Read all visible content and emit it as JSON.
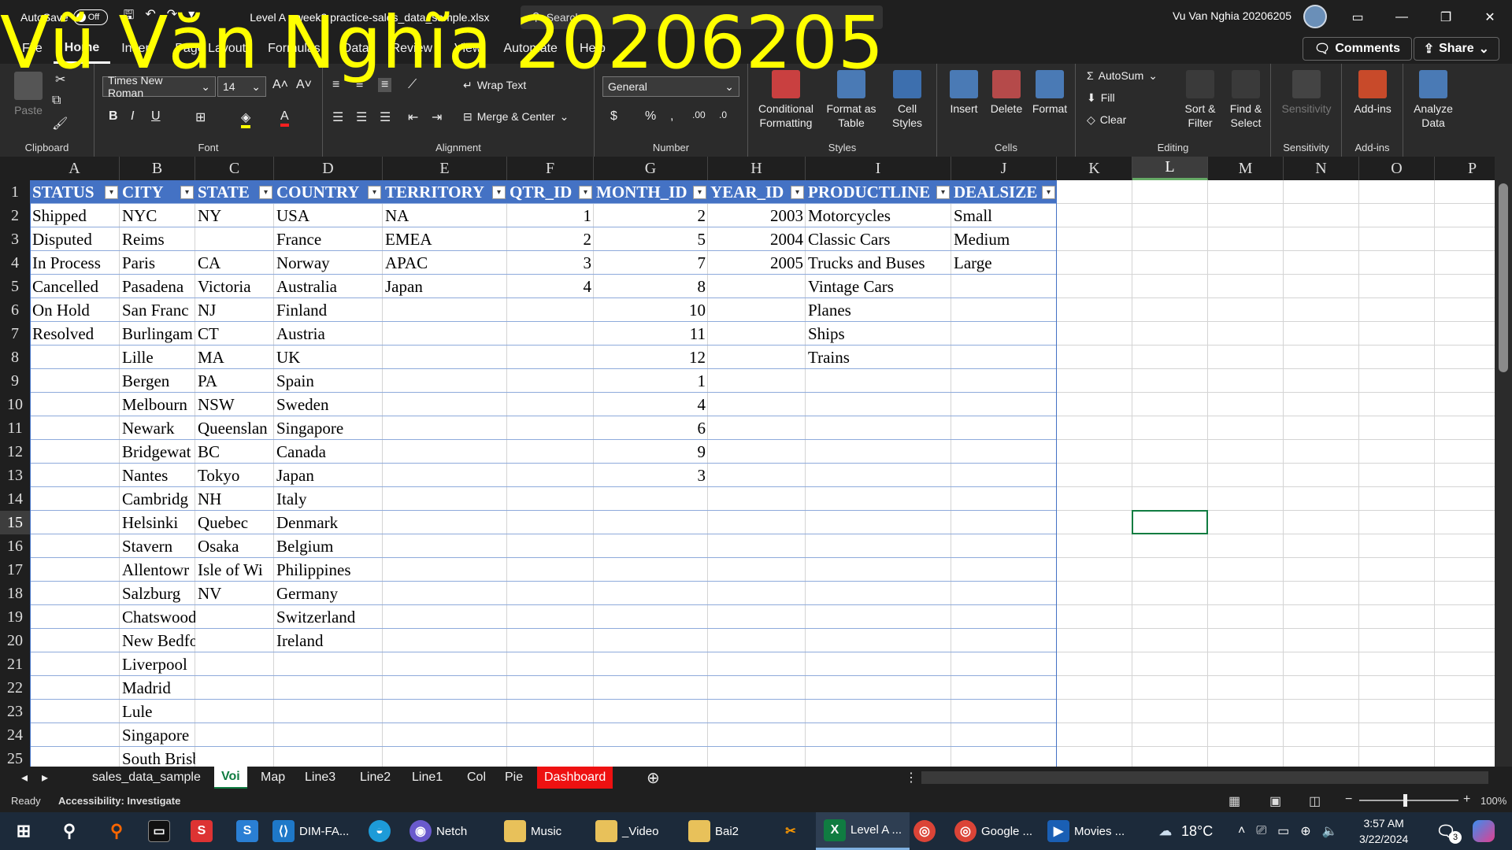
{
  "titlebar": {
    "autosave_label": "AutoSave",
    "autosave_state": "Off",
    "filename": "Level A - week2 practice-sales_data_sample.xlsx",
    "search_placeholder": "Search",
    "user_name": "Vu Van Nghia 20206205"
  },
  "tabs": [
    "File",
    "Home",
    "Insert",
    "Page Layout",
    "Formulas",
    "Data",
    "Review",
    "View",
    "Automate",
    "Help"
  ],
  "ribbon": {
    "comments_label": "Comments",
    "share_label": "Share",
    "clipboard": {
      "paste": "Paste",
      "label": "Clipboard"
    },
    "font": {
      "name": "Times New Roman",
      "size": "14",
      "label": "Font"
    },
    "alignment": {
      "wrap_text": "Wrap Text",
      "merge_center": "Merge & Center",
      "label": "Alignment"
    },
    "number": {
      "format": "General",
      "label": "Number"
    },
    "styles": {
      "conditional": "Conditional Formatting",
      "format_table": "Format as Table",
      "cell_styles": "Cell Styles",
      "label": "Styles"
    },
    "cells": {
      "insert": "Insert",
      "delete": "Delete",
      "format": "Format",
      "label": "Cells"
    },
    "editing": {
      "autosum": "AutoSum",
      "fill": "Fill",
      "clear": "Clear",
      "sort_filter": "Sort & Filter",
      "find_select": "Find & Select",
      "label": "Editing"
    },
    "sensitivity": {
      "button": "Sensitivity",
      "label": "Sensitivity"
    },
    "addins": {
      "button": "Add-ins",
      "label": "Add-ins"
    },
    "analyze": {
      "button": "Analyze Data"
    }
  },
  "columns": [
    "A",
    "B",
    "C",
    "D",
    "E",
    "F",
    "G",
    "H",
    "I",
    "J",
    "K",
    "L",
    "M",
    "N",
    "O",
    "P"
  ],
  "rows": [
    "1",
    "2",
    "3",
    "4",
    "5",
    "6",
    "7",
    "8",
    "9",
    "10",
    "11",
    "12",
    "13",
    "14",
    "15",
    "16",
    "17",
    "18",
    "19",
    "20",
    "21",
    "22",
    "23",
    "24",
    "25"
  ],
  "table_headers": [
    "STATUS",
    "CITY",
    "STATE",
    "COUNTRY",
    "TERRITORY",
    "QTR_ID",
    "MONTH_ID",
    "YEAR_ID",
    "PRODUCTLINE",
    "DEALSIZE"
  ],
  "table_rows": [
    [
      "Shipped",
      "NYC",
      "NY",
      "USA",
      "NA",
      "1",
      "2",
      "2003",
      "Motorcycles",
      "Small"
    ],
    [
      "Disputed",
      "Reims",
      "",
      "France",
      "EMEA",
      "2",
      "5",
      "2004",
      "Classic Cars",
      "Medium"
    ],
    [
      "In Process",
      "Paris",
      "CA",
      "Norway",
      "APAC",
      "3",
      "7",
      "2005",
      "Trucks and Buses",
      "Large"
    ],
    [
      "Cancelled",
      "Pasadena",
      "Victoria",
      "Australia",
      "Japan",
      "4",
      "8",
      "",
      "Vintage Cars",
      ""
    ],
    [
      "On Hold",
      "San Franc",
      "NJ",
      "Finland",
      "",
      "",
      "10",
      "",
      "Planes",
      ""
    ],
    [
      "Resolved",
      "Burlingam",
      "CT",
      "Austria",
      "",
      "",
      "11",
      "",
      "Ships",
      ""
    ],
    [
      "",
      "Lille",
      "MA",
      "UK",
      "",
      "",
      "12",
      "",
      "Trains",
      ""
    ],
    [
      "",
      "Bergen",
      "PA",
      "Spain",
      "",
      "",
      "1",
      "",
      "",
      ""
    ],
    [
      "",
      "Melbourn",
      "NSW",
      "Sweden",
      "",
      "",
      "4",
      "",
      "",
      ""
    ],
    [
      "",
      "Newark",
      "Queenslan",
      "Singapore",
      "",
      "",
      "6",
      "",
      "",
      ""
    ],
    [
      "",
      "Bridgewat",
      "BC",
      "Canada",
      "",
      "",
      "9",
      "",
      "",
      ""
    ],
    [
      "",
      "Nantes",
      "Tokyo",
      "Japan",
      "",
      "",
      "3",
      "",
      "",
      ""
    ],
    [
      "",
      "Cambridg",
      "NH",
      "Italy",
      "",
      "",
      "",
      "",
      "",
      ""
    ],
    [
      "",
      "Helsinki",
      "Quebec",
      "Denmark",
      "",
      "",
      "",
      "",
      "",
      ""
    ],
    [
      "",
      "Stavern",
      "Osaka",
      "Belgium",
      "",
      "",
      "",
      "",
      "",
      ""
    ],
    [
      "",
      "Allentowr",
      "Isle of Wi",
      "Philippines",
      "",
      "",
      "",
      "",
      "",
      ""
    ],
    [
      "",
      "Salzburg",
      "NV",
      "Germany",
      "",
      "",
      "",
      "",
      "",
      ""
    ],
    [
      "",
      "Chatswood",
      "",
      "Switzerland",
      "",
      "",
      "",
      "",
      "",
      ""
    ],
    [
      "",
      "New Bedford",
      "",
      "Ireland",
      "",
      "",
      "",
      "",
      "",
      ""
    ],
    [
      "",
      "Liverpool",
      "",
      "",
      "",
      "",
      "",
      "",
      "",
      ""
    ],
    [
      "",
      "Madrid",
      "",
      "",
      "",
      "",
      "",
      "",
      "",
      ""
    ],
    [
      "",
      "Lule",
      "",
      "",
      "",
      "",
      "",
      "",
      "",
      ""
    ],
    [
      "",
      "Singapore",
      "",
      "",
      "",
      "",
      "",
      "",
      "",
      ""
    ],
    [
      "",
      "South Brisbane",
      "",
      "",
      "",
      "",
      "",
      "",
      "",
      ""
    ]
  ],
  "sheets": [
    "sales_data_sample",
    "Voi",
    "Map",
    "Line3",
    "Line2",
    "Line1",
    "Col",
    "Pie",
    "Dashboard"
  ],
  "active_sheet": "Voi",
  "status": {
    "ready": "Ready",
    "accessibility": "Accessibility: Investigate",
    "zoom": "100%"
  },
  "taskbar": {
    "items": [
      "DIM-FA...",
      "Netch",
      "Music",
      "_Video",
      "Bai2",
      "Level A ...",
      "Google ...",
      "Movies ..."
    ],
    "weather": "18°C",
    "time": "3:57 AM",
    "date": "3/22/2024",
    "notif_count": "3"
  },
  "overlay_text": "Vũ Văn Nghĩa 20206205",
  "colors": {
    "table_header": "#4472c4",
    "excel_green": "#107c41",
    "overlay": "#ffff00",
    "dashboard_tab": "#ee1111"
  }
}
